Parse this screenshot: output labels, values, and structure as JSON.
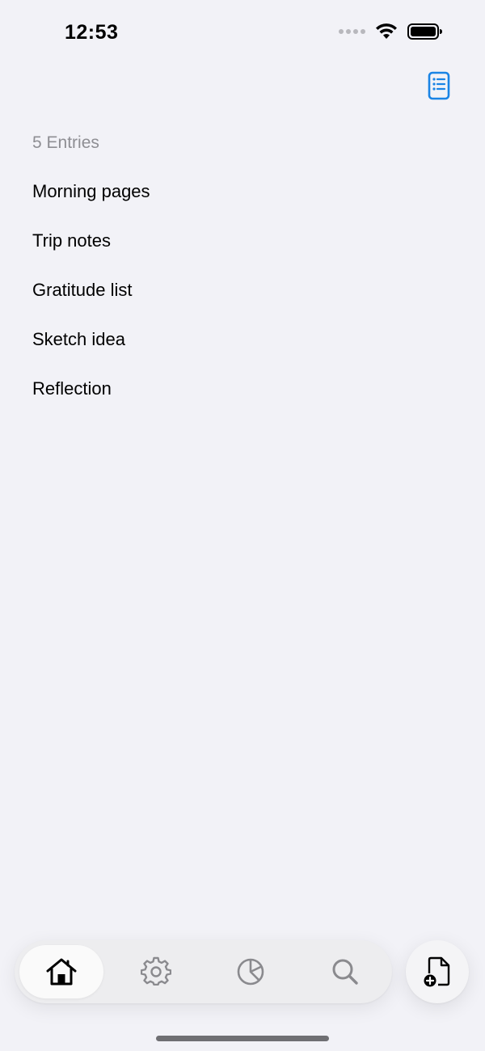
{
  "status_bar": {
    "time": "12:53",
    "icons": [
      "cellular-dots-icon",
      "wifi-icon",
      "battery-icon"
    ]
  },
  "header": {
    "action_icon": "list-document-icon",
    "accent_color": "#1a84e5"
  },
  "entries": {
    "count_label": "5 Entries",
    "items": [
      {
        "title": "Morning pages"
      },
      {
        "title": "Trip notes"
      },
      {
        "title": "Gratitude list"
      },
      {
        "title": "Sketch idea"
      },
      {
        "title": "Reflection"
      }
    ]
  },
  "tab_bar": {
    "tabs": [
      {
        "icon": "house-icon",
        "active": true
      },
      {
        "icon": "gear-icon",
        "active": false
      },
      {
        "icon": "pie-chart-icon",
        "active": false
      },
      {
        "icon": "search-icon",
        "active": false
      }
    ],
    "new_entry_icon": "document-add-icon"
  }
}
